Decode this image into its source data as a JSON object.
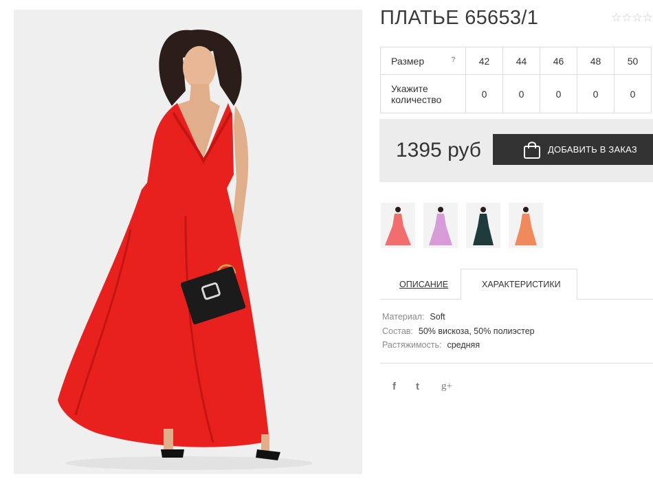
{
  "product": {
    "title": "ПЛАТЬЕ 65653/1",
    "rating_stars": "☆☆☆☆"
  },
  "sizes": {
    "size_label": "Размер",
    "help_mark": "?",
    "qty_label": "Укажите количество",
    "columns": [
      "42",
      "44",
      "46",
      "48",
      "50"
    ],
    "quantities": [
      "0",
      "0",
      "0",
      "0",
      "0"
    ]
  },
  "purchase": {
    "price": "1395 руб",
    "order_button": "ДОБАВИТЬ В ЗАКАЗ",
    "button_color": "#333333"
  },
  "thumbnails": {
    "colors": [
      "#f26d6d",
      "#d79bd8",
      "#1f3a3a",
      "#f08a5d"
    ]
  },
  "tabs": {
    "description": "ОПИСАНИЕ",
    "characteristics": "ХАРАКТЕРИСТИКИ",
    "active": "characteristics"
  },
  "specs": [
    {
      "key": "Материал:",
      "value": "Soft"
    },
    {
      "key": "Состав:",
      "value": "50% вискоза, 50% полиэстер"
    },
    {
      "key": "Растяжимость:",
      "value": "средняя"
    }
  ],
  "social": {
    "facebook": "f",
    "twitter": "t",
    "googleplus": "g+"
  },
  "colors": {
    "dress": "#e8211f",
    "photo_background": "#efefef"
  }
}
